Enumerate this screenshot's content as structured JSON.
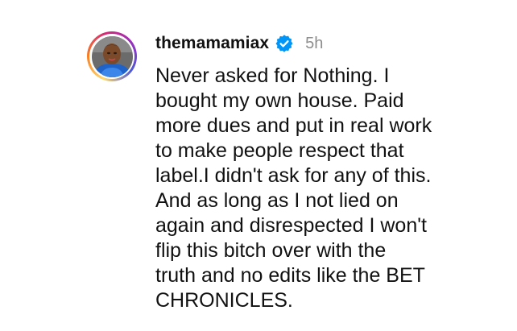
{
  "comment": {
    "username": "themamamiax",
    "verified": true,
    "timestamp": "5h",
    "text_lines": [
      "Never asked for Nothing. I",
      "bought my own house. Paid",
      "more dues and put in real work",
      "to make people respect that",
      "label.I didn't ask for any of this.",
      "And as long as I not lied on",
      "again and disrespected I won't",
      "flip this bitch over with the",
      "truth and no edits like the BET",
      "CHRONICLES."
    ]
  },
  "colors": {
    "verified_badge": "#0095f6",
    "timestamp": "#8e8e8e",
    "text": "#111111",
    "story_ring": [
      "#feda75",
      "#fa7e1e",
      "#d62976",
      "#962fbf",
      "#4f5bd5"
    ]
  },
  "icons": {
    "verified": "verified-badge-icon",
    "avatar": "user-avatar"
  }
}
